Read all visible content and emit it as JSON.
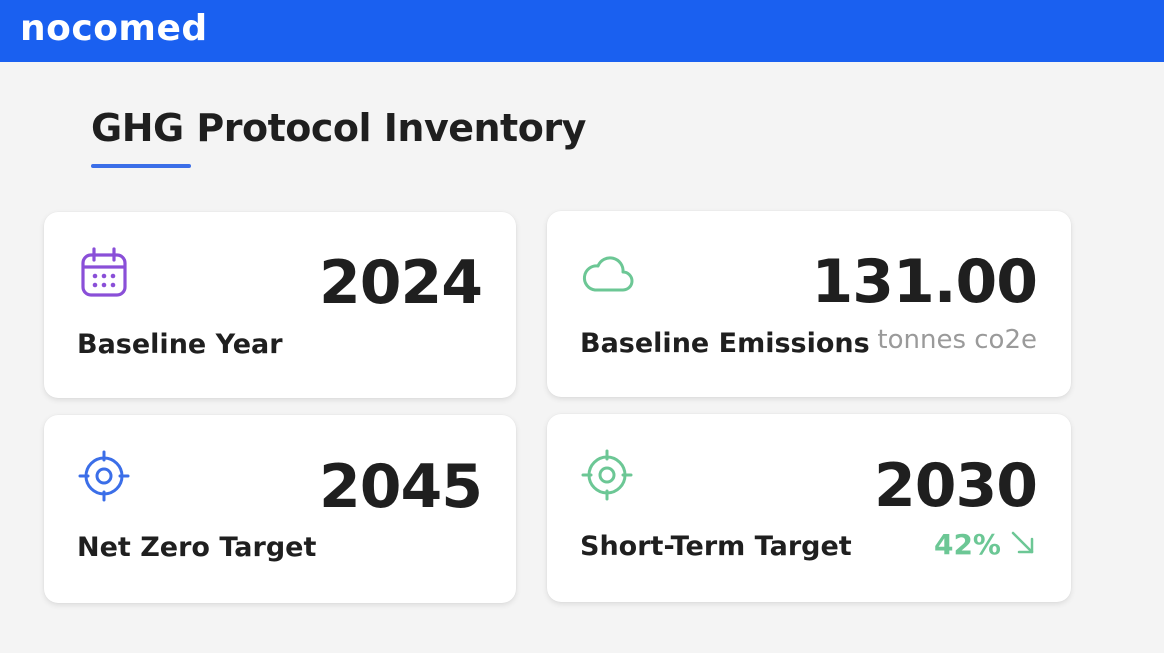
{
  "header": {
    "logo": "nocomed"
  },
  "page": {
    "title": "GHG Protocol Inventory"
  },
  "colors": {
    "topbar": "#1a60f0",
    "underline": "#3b6ee8",
    "calendar_icon": "#8a4fd8",
    "cloud_icon": "#6cc795",
    "target_icon_blue": "#3b6ee8",
    "target_icon_green": "#6cc795",
    "reduction": "#6cc795"
  },
  "cards": {
    "baseline_year": {
      "value": "2024",
      "label": "Baseline Year",
      "icon": "calendar-icon"
    },
    "baseline_emissions": {
      "value": "131.00",
      "unit": "tonnes co2e",
      "label": "Baseline Emissions",
      "icon": "cloud-icon"
    },
    "net_zero": {
      "value": "2045",
      "label": "Net Zero Target",
      "icon": "target-icon"
    },
    "short_term": {
      "value": "2030",
      "label": "Short-Term Target",
      "reduction": "42%",
      "icon": "target-icon",
      "trend_icon": "arrow-down-right-icon"
    }
  }
}
